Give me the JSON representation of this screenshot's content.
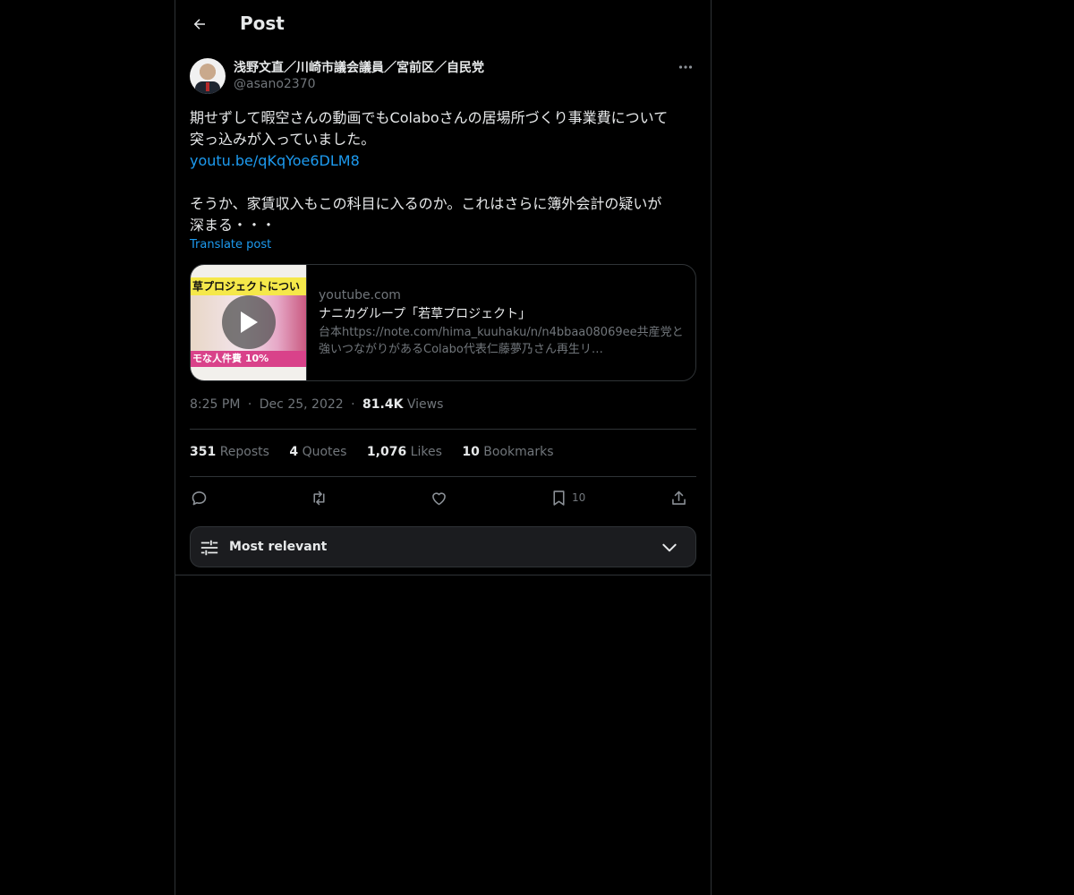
{
  "header": {
    "title": "Post"
  },
  "author": {
    "name": "浅野文直／川崎市議会議員／宮前区／自民党",
    "handle": "@asano2370"
  },
  "post": {
    "lines": [
      "期せずして暇空さんの動画でもColaboさんの居場所づくり事業費について",
      "突っ込みが入っていました。"
    ],
    "link": "youtu.be/qKqYoe6DLM8",
    "lines2": [
      "そうか、家賃収入もこの科目に入るのか。これはさらに簿外会計の疑いが",
      "深まる・・・"
    ],
    "translate_label": "Translate post"
  },
  "card": {
    "thumb_top_text": "草プロジェクトについ",
    "thumb_bottom_text": "モな人件費 10%",
    "domain": "youtube.com",
    "title": "ナニカグループ「若草プロジェクト」",
    "description": "台本https://note.com/hima_kuuhaku/n/n4bbaa08069ee共産党と強いつながりがあるColabo代表仁藤夢乃さん再生リ…"
  },
  "meta": {
    "time": "8:25 PM",
    "date": "Dec 25, 2022",
    "views_count": "81.4K",
    "views_label": "Views",
    "separator": "·"
  },
  "stats": [
    {
      "count": "351",
      "label": "Reposts"
    },
    {
      "count": "4",
      "label": "Quotes"
    },
    {
      "count": "1,076",
      "label": "Likes"
    },
    {
      "count": "10",
      "label": "Bookmarks"
    }
  ],
  "actions": {
    "bookmark_count": "10"
  },
  "sort": {
    "label": "Most relevant"
  },
  "colors": {
    "accent": "#1d9bf0",
    "muted": "#71767b",
    "text": "#e7e9ea",
    "border": "#2f3336",
    "background": "#000000"
  },
  "icons": {
    "back": "arrow-left-icon",
    "more": "more-horizontal-icon",
    "play": "play-icon",
    "reply": "reply-icon",
    "repost": "repost-icon",
    "like": "heart-icon",
    "bookmark": "bookmark-icon",
    "share": "share-icon",
    "sort": "sliders-icon",
    "chevron": "chevron-down-icon"
  }
}
